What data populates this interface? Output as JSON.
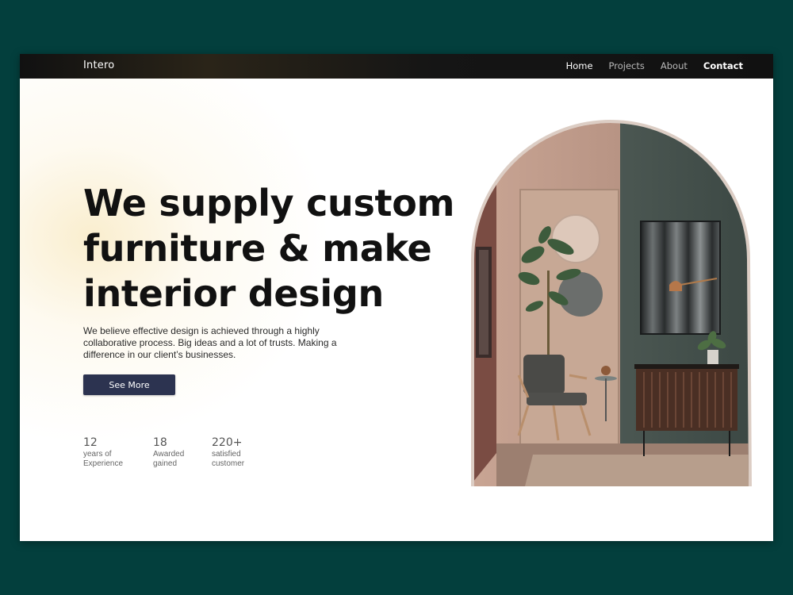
{
  "header": {
    "brand": "Intero",
    "nav": [
      {
        "label": "Home"
      },
      {
        "label": "Projects"
      },
      {
        "label": "About"
      },
      {
        "label": "Contact"
      }
    ]
  },
  "hero": {
    "title_lines": [
      "We supply custom",
      "furniture & make",
      "interior design"
    ],
    "description": "We believe effective design is achieved through a highly collaborative process. Big ideas and a lot of trusts. Making a difference in our client’s businesses.",
    "cta_label": "See More"
  },
  "stats": [
    {
      "value": "12",
      "label_line1": "years of",
      "label_line2": "Experience"
    },
    {
      "value": "18",
      "label_line1": "Awarded",
      "label_line2": "gained"
    },
    {
      "value": "220+",
      "label_line1": "satisfied",
      "label_line2": "customer"
    }
  ],
  "colors": {
    "page_background": "#033f3d",
    "button": "#2c3350",
    "nav_bar": "#111111"
  }
}
